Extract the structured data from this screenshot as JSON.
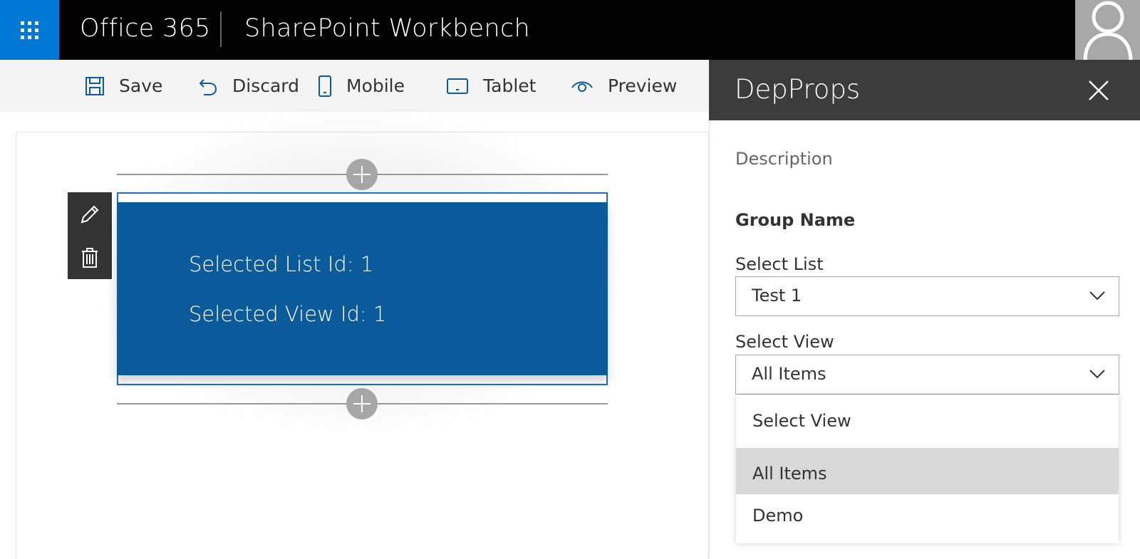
{
  "suite": {
    "brand": "Office 365",
    "app_title": "SharePoint Workbench",
    "waffle_icon": "app-launcher-icon",
    "accent_color": "#0078d4"
  },
  "commands": {
    "save": "Save",
    "discard": "Discard",
    "mobile": "Mobile",
    "tablet": "Tablet",
    "preview": "Preview"
  },
  "webpart": {
    "line1": "Selected List Id: 1",
    "line2": "Selected View Id: 1",
    "background": "#0b5b9b"
  },
  "pane": {
    "title": "DepProps",
    "description": "Description",
    "group_name": "Group Name",
    "select_list_label": "Select List",
    "select_list_value": "Test 1",
    "select_view_label": "Select View",
    "select_view_value": "All Items",
    "view_options": [
      "Select View",
      "All Items",
      "Demo"
    ],
    "selected_option": "All Items"
  }
}
